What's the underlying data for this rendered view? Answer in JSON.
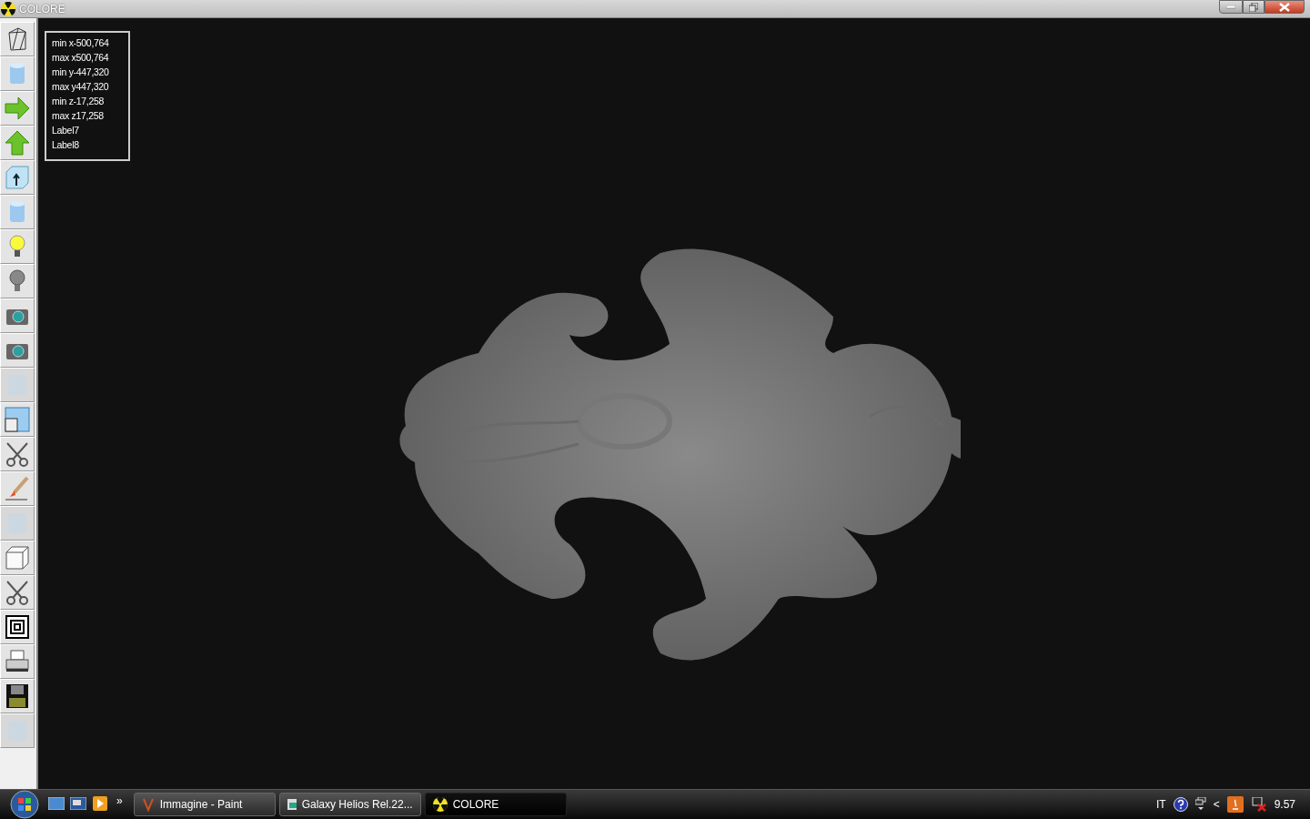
{
  "window": {
    "title": "COLORE"
  },
  "toolbar": [
    {
      "kind": "wireframe",
      "disabled": false
    },
    {
      "kind": "cylinder",
      "disabled": false
    },
    {
      "kind": "arrow-right",
      "disabled": false
    },
    {
      "kind": "arrow-up",
      "disabled": false
    },
    {
      "kind": "box-arrow",
      "disabled": false
    },
    {
      "kind": "cylinder",
      "disabled": false
    },
    {
      "kind": "bulb-on",
      "disabled": false
    },
    {
      "kind": "bulb-off",
      "disabled": false
    },
    {
      "kind": "camera",
      "disabled": false
    },
    {
      "kind": "camera",
      "disabled": false
    },
    {
      "kind": "texture",
      "disabled": true
    },
    {
      "kind": "window",
      "disabled": false
    },
    {
      "kind": "scissors",
      "disabled": false
    },
    {
      "kind": "brush",
      "disabled": false
    },
    {
      "kind": "texture",
      "disabled": true
    },
    {
      "kind": "cube",
      "disabled": false
    },
    {
      "kind": "scissors",
      "disabled": false
    },
    {
      "kind": "squares",
      "disabled": false
    },
    {
      "kind": "printer",
      "disabled": false
    },
    {
      "kind": "floppy",
      "disabled": false
    },
    {
      "kind": "texture",
      "disabled": true
    }
  ],
  "info_labels": [
    "min x-500,764",
    "max x500,764",
    "min y-447,320",
    "max y447,320",
    "min z-17,258",
    "max z17,258",
    "Label7",
    "Label8"
  ],
  "taskbar": {
    "overflow": "»",
    "tasks": [
      {
        "label": "Immagine - Paint",
        "kind": "paint",
        "selected": false
      },
      {
        "label": "Galaxy Helios  Rel.22...",
        "kind": "helios",
        "selected": false
      },
      {
        "label": "COLORE",
        "kind": "colore",
        "selected": true
      }
    ],
    "language": "IT",
    "tray_chevron": "<",
    "clock": "9.57"
  }
}
